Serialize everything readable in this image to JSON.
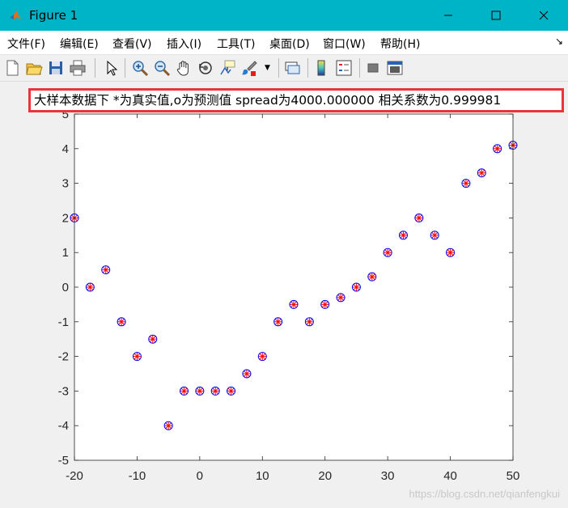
{
  "window": {
    "title": "Figure 1",
    "controls": [
      "minimize",
      "maximize",
      "close"
    ]
  },
  "menubar": {
    "items": [
      "文件(F)",
      "编辑(E)",
      "查看(V)",
      "插入(I)",
      "工具(T)",
      "桌面(D)",
      "窗口(W)",
      "帮助(H)"
    ]
  },
  "toolbar": {
    "icons": [
      "new-figure-icon",
      "open-file-icon",
      "save-icon",
      "print-icon",
      "pointer-icon",
      "zoom-in-icon",
      "zoom-out-icon",
      "pan-icon",
      "rotate-3d-icon",
      "data-cursor-icon",
      "brush-icon",
      "link-plot-icon",
      "colorbar-icon",
      "legend-icon",
      "hide-plot-tools-icon",
      "show-plot-tools-icon"
    ]
  },
  "chart_data": {
    "type": "scatter",
    "title": "大样本数据下 *为真实值,o为预测值 spread为4000.000000 相关系数为0.999981",
    "xlim": [
      -20,
      50
    ],
    "ylim": [
      -5,
      5
    ],
    "xticks": [
      -20,
      -10,
      0,
      10,
      20,
      30,
      40,
      50
    ],
    "yticks": [
      -5,
      -4,
      -3,
      -2,
      -1,
      0,
      1,
      2,
      3,
      4,
      5
    ],
    "grid": false,
    "colors": {
      "actual": "#ff0000",
      "predicted": "#0000ff"
    },
    "series": [
      {
        "marker": "*",
        "color": "#ff0000",
        "x": [
          -20,
          -17.5,
          -15,
          -12.5,
          -10,
          -7.5,
          -5,
          -2.5,
          0,
          2.5,
          5,
          7.5,
          10,
          12.5,
          15,
          17.5,
          20,
          22.5,
          25,
          27.5,
          30,
          32.5,
          35,
          37.5,
          40,
          42.5,
          45,
          47.5,
          50
        ],
        "y": [
          2,
          0,
          0.5,
          -1,
          -2,
          -1.5,
          -4,
          -3,
          -3,
          -3,
          -3,
          -2.5,
          -2,
          -1,
          -0.5,
          -1,
          -0.5,
          -0.3,
          0,
          0.3,
          1,
          1.5,
          2,
          1.5,
          1,
          3,
          3.3,
          4,
          4.1
        ]
      },
      {
        "marker": "o",
        "color": "#0000ff",
        "x": [
          -20,
          -17.5,
          -15,
          -12.5,
          -10,
          -7.5,
          -5,
          -2.5,
          0,
          2.5,
          5,
          7.5,
          10,
          12.5,
          15,
          17.5,
          20,
          22.5,
          25,
          27.5,
          30,
          32.5,
          35,
          37.5,
          40,
          42.5,
          45,
          47.5,
          50
        ],
        "y": [
          2,
          0,
          0.5,
          -1,
          -2,
          -1.5,
          -4,
          -3,
          -3,
          -3,
          -3,
          -2.5,
          -2,
          -1,
          -0.5,
          -1,
          -0.5,
          -0.3,
          0,
          0.3,
          1,
          1.5,
          2,
          1.5,
          1,
          3,
          3.3,
          4,
          4.1
        ]
      }
    ]
  },
  "watermark": "https://blog.csdn.net/qianfengkui"
}
